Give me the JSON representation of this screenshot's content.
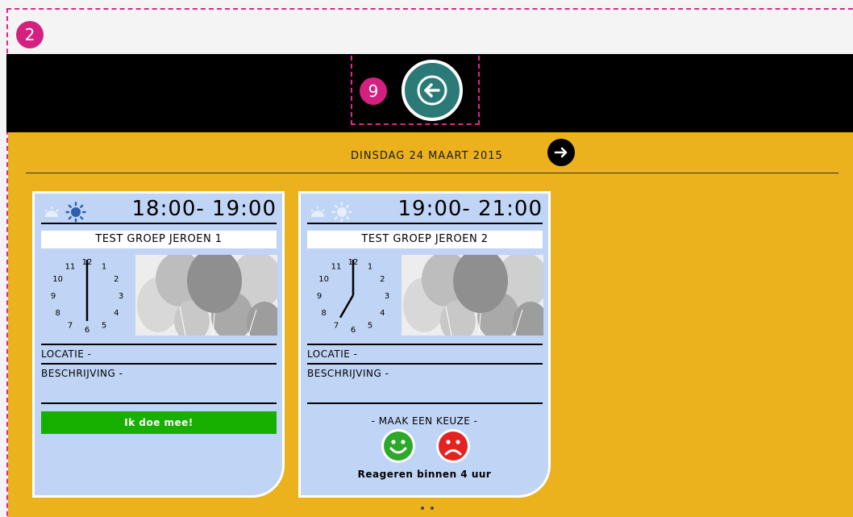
{
  "annotations": {
    "frame_badge": "2",
    "back_badge": "9"
  },
  "header": {
    "date": "DINSDAG 24 MAART 2015"
  },
  "colors": {
    "accent": "#ebb21e",
    "card": "#c0d4f6",
    "join": "#18b000",
    "back": "#2b7a78",
    "badge": "#d4207f"
  },
  "cards": [
    {
      "time": "18:00- 19:00",
      "title": "TEST GROEP JEROEN 1",
      "active_time_icon": "sun",
      "clock": {
        "hour": 6,
        "minute": 0
      },
      "location_label": "LOCATIE -",
      "description_label": "BESCHRIJVING -",
      "join_label": "Ik doe mee!"
    },
    {
      "time": "19:00- 21:00",
      "title": "TEST GROEP JEROEN 2",
      "active_time_icon": "moon",
      "clock": {
        "hour": 7,
        "minute": 0
      },
      "location_label": "LOCATIE -",
      "description_label": "BESCHRIJVING -",
      "choice_title": "- MAAK EEN KEUZE -",
      "react_note": "Reageren binnen 4 uur"
    }
  ],
  "clock_numbers": [
    "12",
    "1",
    "2",
    "3",
    "4",
    "5",
    "6",
    "7",
    "8",
    "9",
    "10",
    "11"
  ],
  "icons": [
    "arrow-left-icon",
    "arrow-right-icon",
    "sunrise-icon",
    "sun-icon",
    "moon-icon",
    "happy-smiley-icon",
    "sad-smiley-icon",
    "balloons-image"
  ],
  "pager": {
    "pages": 2,
    "current": 1
  }
}
